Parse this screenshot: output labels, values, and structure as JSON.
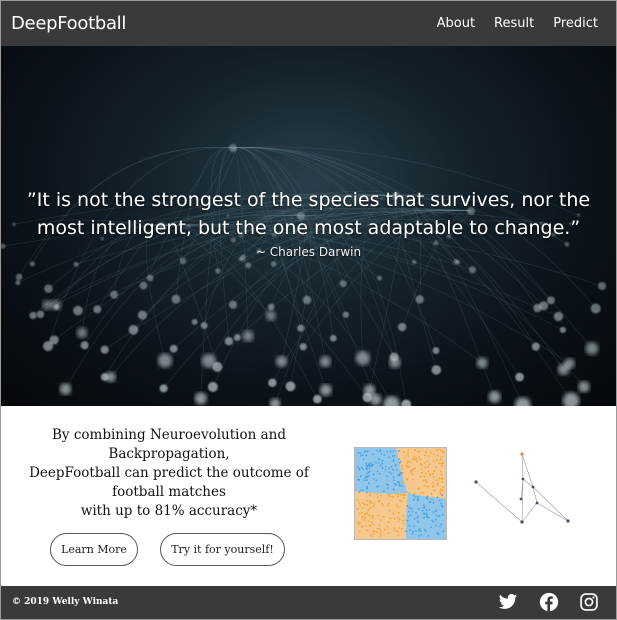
{
  "header": {
    "brand": "DeepFootball",
    "nav": [
      "About",
      "Result",
      "Predict"
    ]
  },
  "hero": {
    "quote": "”It is not the strongest of the species that survives, nor the most intelligent, but the one most adaptable to change.”",
    "author": "~ Charles Darwin"
  },
  "info": {
    "tagline_lines": [
      "By combining Neuroevolution and",
      "Backpropagation,",
      "DeepFootball can predict the outcome of",
      "football matches",
      "with up to 81% accuracy*"
    ],
    "learn_more_label": "Learn More",
    "try_label": "Try it for yourself!"
  },
  "footer": {
    "copyright": "© 2019 Welly Winata",
    "social_icons": [
      "twitter-icon",
      "facebook-icon",
      "instagram-icon"
    ]
  },
  "colors": {
    "navbar": "#3a3a3a",
    "plot_orange": "#f6c88d",
    "plot_blue": "#8fc6ea"
  }
}
